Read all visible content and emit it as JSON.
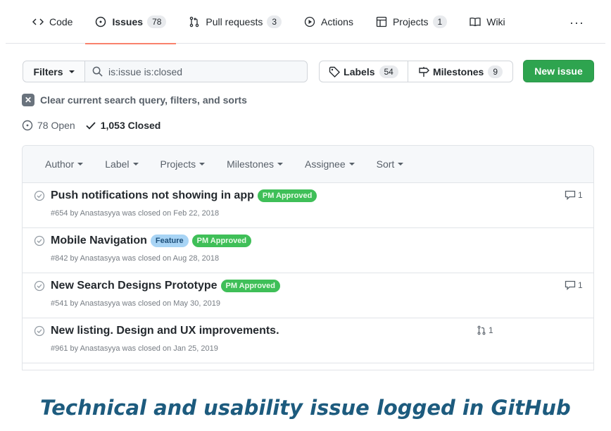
{
  "nav": {
    "tabs": [
      {
        "label": "Code",
        "icon": "code-icon",
        "count": null,
        "selected": false
      },
      {
        "label": "Issues",
        "icon": "issue-opened-icon",
        "count": "78",
        "selected": true
      },
      {
        "label": "Pull requests",
        "icon": "pull-request-icon",
        "count": "3",
        "selected": false
      },
      {
        "label": "Actions",
        "icon": "play-icon",
        "count": null,
        "selected": false
      },
      {
        "label": "Projects",
        "icon": "project-icon",
        "count": "1",
        "selected": false
      },
      {
        "label": "Wiki",
        "icon": "book-icon",
        "count": null,
        "selected": false
      }
    ],
    "more_glyph": "···"
  },
  "toolbar": {
    "filters_label": "Filters",
    "search_value": "is:issue is:closed",
    "labels_label": "Labels",
    "labels_count": "54",
    "milestones_label": "Milestones",
    "milestones_count": "9",
    "new_issue_label": "New issue"
  },
  "clear_filters_label": "Clear current search query, filters, and sorts",
  "states": {
    "open_label": "78 Open",
    "closed_label": "1,053 Closed"
  },
  "list_header": {
    "author": "Author",
    "label": "Label",
    "projects": "Projects",
    "milestones": "Milestones",
    "assignee": "Assignee",
    "sort": "Sort"
  },
  "issues": [
    {
      "title": "Push notifications not showing in app",
      "labels": [
        {
          "text": "PM Approved",
          "color": "#3fbf58"
        }
      ],
      "meta": "#654 by Anastasyya was closed on Feb 22, 2018",
      "comments": "1",
      "linked_prs": null
    },
    {
      "title": "Mobile Navigation",
      "labels": [
        {
          "text": "Feature",
          "color": "#a8d4f5"
        },
        {
          "text": "PM Approved",
          "color": "#3fbf58"
        }
      ],
      "meta": "#842 by Anastasyya was closed on Aug 28, 2018",
      "comments": null,
      "linked_prs": null
    },
    {
      "title": "New Search Designs Prototype",
      "labels": [
        {
          "text": "PM Approved",
          "color": "#3fbf58"
        }
      ],
      "meta": "#541 by Anastasyya was closed on May 30, 2019",
      "comments": "1",
      "linked_prs": null
    },
    {
      "title": "New listing. Design and UX improvements.",
      "labels": [],
      "meta": "#961 by Anastasyya was closed on Jan 25, 2019",
      "comments": null,
      "linked_prs": "1"
    }
  ],
  "caption": "Technical and usability issue logged in GitHub",
  "colors": {
    "primary_button": "#2ea44f",
    "selected_tab_underline": "#f9826c",
    "caption": "#1d5b7e"
  }
}
